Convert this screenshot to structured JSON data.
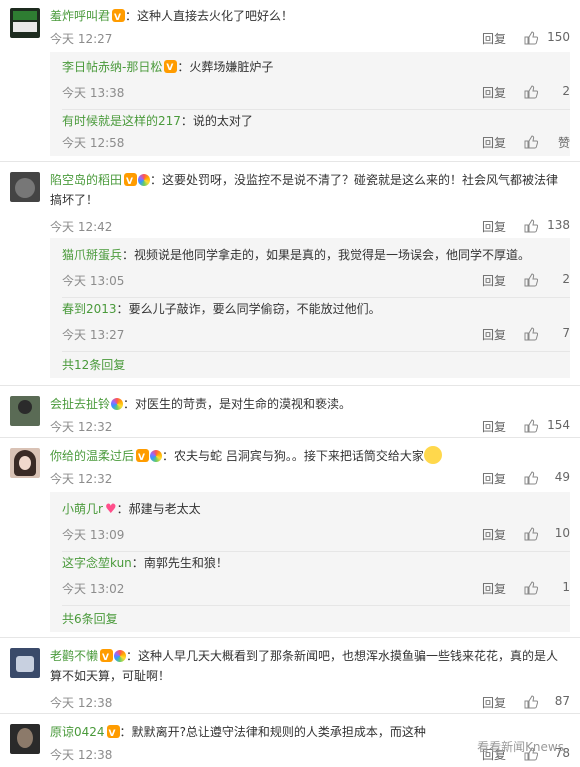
{
  "colors": {
    "username": "#4a9a3b",
    "text": "#333333",
    "meta": "#8c8c8c",
    "subbg": "#f5f5f5"
  },
  "icons": {
    "like": "thumbs-up-icon",
    "verified": "v-badge-icon",
    "rainbow": "rainbow-badge-icon"
  },
  "comments": [
    {
      "user": "羞炸呼叫君",
      "text": "这种人直接去火化了吧好么！",
      "time": "今天 12:27",
      "reply": "回复",
      "likes": "150",
      "subs": [
        {
          "user": "李日帖赤纳-那日松",
          "text": "火葬场嫌脏炉子",
          "time": "今天 13:38",
          "reply": "回复",
          "likes": "2"
        },
        {
          "user": "有时候就是这样的217",
          "text": "说的太对了",
          "time": "今天 12:58",
          "reply": "回复",
          "likes": "赞"
        }
      ]
    },
    {
      "user": "陷空岛的稻田",
      "text": "这要处罚呀，没监控不是说不清了？碰瓷就是这么来的！社会风气都被法律搞坏了！",
      "time": "今天 12:42",
      "reply": "回复",
      "likes": "138",
      "subs": [
        {
          "user": "猫爪掰蛋兵",
          "text": "视频说是他同学拿走的，如果是真的，我觉得是一场误会，他同学不厚道。",
          "time": "今天 13:05",
          "reply": "回复",
          "likes": "2"
        },
        {
          "user": "春到2013",
          "text": "要么儿子敲诈，要么同学偷窃，不能放过他们。",
          "time": "今天 13:27",
          "reply": "回复",
          "likes": "7"
        }
      ],
      "more": "共12条回复"
    },
    {
      "user": "会扯去扯铃",
      "text": "对医生的苛责，是对生命的漠视和亵渎。",
      "time": "今天 12:32",
      "reply": "回复",
      "likes": "154"
    },
    {
      "user": "你给的温柔过后",
      "text": "农夫与蛇 吕洞宾与狗。。接下来把话筒交给大家",
      "time": "今天 12:32",
      "reply": "回复",
      "likes": "49",
      "subs": [
        {
          "user": "小萌几r",
          "text": "郝建与老太太",
          "time": "今天 13:09",
          "reply": "回复",
          "likes": "10"
        },
        {
          "user": "这字念堃kun",
          "text": "南郭先生和狼！",
          "time": "今天 13:02",
          "reply": "回复",
          "likes": "1"
        }
      ],
      "more": "共6条回复"
    },
    {
      "user": "老鹳不懒",
      "text": "这种人早几天大概看到了那条新闻吧，也想浑水摸鱼骗一些钱来花花，真的是人算不如天算，可耻啊！",
      "time": "今天 12:38",
      "reply": "回复",
      "likes": "87"
    },
    {
      "user": "原谅0424",
      "text": "默默离开?总让遵守法律和规则的人类承担成本，而这种",
      "time": "今天 12:38",
      "reply": "回复",
      "likes": "78"
    }
  ],
  "watermark": "看看新闻Knews"
}
